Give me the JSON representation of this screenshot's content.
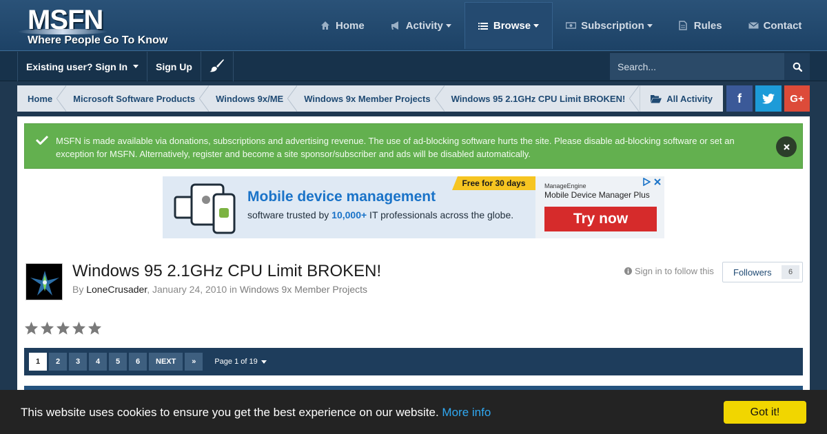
{
  "site": {
    "logo": "MSFN",
    "tagline": "Where People Go To Know"
  },
  "mainnav": [
    {
      "label": "Home",
      "icon": "home-icon",
      "dropdown": false
    },
    {
      "label": "Activity",
      "icon": "bullhorn-icon",
      "dropdown": true
    },
    {
      "label": "Browse",
      "icon": "list-icon",
      "dropdown": true,
      "active": true
    },
    {
      "label": "Subscription",
      "icon": "money-icon",
      "dropdown": true
    },
    {
      "label": "Rules",
      "icon": "document-icon",
      "dropdown": false
    },
    {
      "label": "Contact",
      "icon": "envelope-icon",
      "dropdown": false
    }
  ],
  "userbar": {
    "signin_label": "Existing user? Sign In",
    "signup_label": "Sign Up",
    "theme_icon": "paintbrush-icon",
    "search_placeholder": "Search..."
  },
  "breadcrumb": {
    "items": [
      "Home",
      "Microsoft Software Products",
      "Windows 9x/ME",
      "Windows 9x Member Projects",
      "Windows 95 2.1GHz CPU Limit BROKEN!"
    ],
    "all_activity": "All Activity"
  },
  "social": {
    "facebook": "f",
    "twitter": "twitter-icon",
    "googleplus": "G+"
  },
  "notice": {
    "text": "MSFN is made available via donations, subscriptions and advertising revenue. The use of ad-blocking software hurts the site. Please disable ad-blocking software or set an exception for MSFN. Alternatively, register and become a site sponsor/subscriber and ads will be disabled automatically."
  },
  "ad": {
    "ribbon": "Free for 30 days",
    "headline": "Mobile device management",
    "sub_pre": "software trusted by ",
    "sub_bold": "10,000+",
    "sub_post": " IT professionals across the globe.",
    "brand": "ManageEngine",
    "product": "Mobile Device Manager Plus",
    "cta": "Try now"
  },
  "topic": {
    "title": "Windows 95 2.1GHz CPU Limit BROKEN!",
    "by": "By ",
    "author": "LoneCrusader",
    "date": ", January 24, 2010 in ",
    "forum": "Windows 9x Member Projects",
    "sign_in_follow": "Sign in to follow this",
    "followers_label": "Followers",
    "followers_count": "6",
    "rating": 0,
    "rating_max": 5
  },
  "pagination": {
    "pages": [
      "1",
      "2",
      "3",
      "4",
      "5",
      "6"
    ],
    "current": "1",
    "next_label": "NEXT",
    "last_label": "»",
    "page_label": "Page 1 of 19"
  },
  "cookie": {
    "text": "This website uses cookies to ensure you get the best experience on our website.",
    "more_info": "More info",
    "button": "Got it!"
  },
  "colors": {
    "header": "#1d4266",
    "notice": "#63b04f",
    "pagination": "#1e3d5c",
    "cookie_button": "#f1d600",
    "link": "#1f4a73"
  }
}
